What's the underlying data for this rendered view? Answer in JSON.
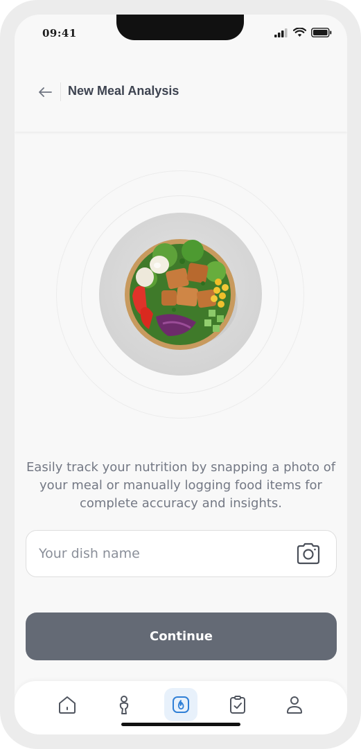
{
  "status_bar": {
    "time": "09:41"
  },
  "header": {
    "title": "New Meal Analysis"
  },
  "main": {
    "description": "Easily track your nutrition by snapping a photo of your meal or manually logging food items for complete accuracy and insights.",
    "dish_input": {
      "placeholder": "Your dish name",
      "value": ""
    },
    "continue_label": "Continue"
  },
  "tabbar": {
    "items": [
      {
        "name": "home",
        "icon": "home-icon",
        "active": false
      },
      {
        "name": "body",
        "icon": "body-icon",
        "active": false
      },
      {
        "name": "meal-analysis",
        "icon": "flame-icon",
        "active": true
      },
      {
        "name": "tasks",
        "icon": "clipboard-check-icon",
        "active": false
      },
      {
        "name": "profile",
        "icon": "user-icon",
        "active": false
      }
    ]
  },
  "colors": {
    "accent": "#2f7fd6",
    "button": "#646a75",
    "text_muted": "#737884",
    "title": "#3d4350"
  }
}
